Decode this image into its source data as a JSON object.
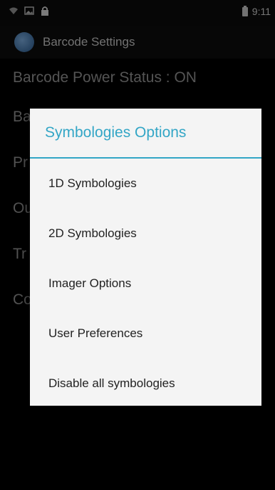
{
  "status_bar": {
    "icons": [
      "wifi-icon",
      "gallery-icon",
      "lock-icon"
    ],
    "time": "9:11"
  },
  "app_bar": {
    "title": "Barcode Settings",
    "icon": "app-icon"
  },
  "background_list": [
    {
      "label": "Barcode Power Status : ON"
    },
    {
      "label": "Ba"
    },
    {
      "label": "Pr"
    },
    {
      "label": "Ou"
    },
    {
      "label": "Tr"
    },
    {
      "label": "Co"
    }
  ],
  "dialog": {
    "title": "Symbologies Options",
    "options": [
      {
        "label": "1D Symbologies"
      },
      {
        "label": "2D Symbologies"
      },
      {
        "label": "Imager Options"
      },
      {
        "label": "User Preferences"
      },
      {
        "label": "Disable all symbologies"
      }
    ]
  },
  "colors": {
    "accent": "#33a6c6",
    "dialog_bg": "#f4f4f4",
    "screen_bg": "#000000"
  }
}
